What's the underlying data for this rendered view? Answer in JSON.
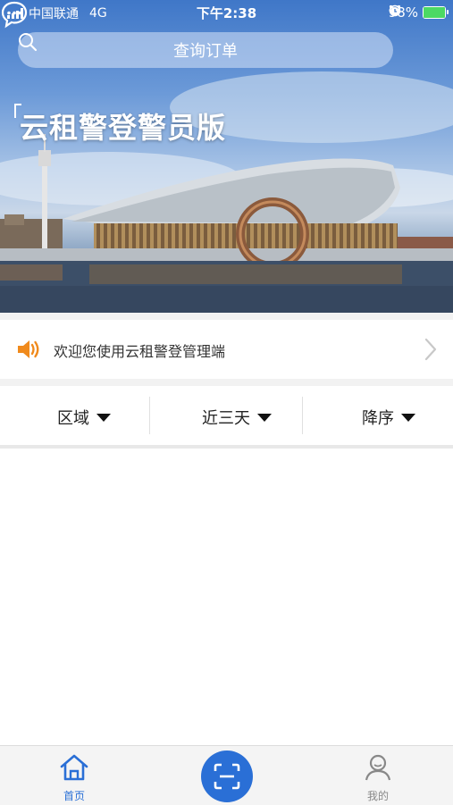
{
  "status_bar": {
    "carrier": "中国联通",
    "network": "4G",
    "time": "下午2:38",
    "battery_percent": "98%"
  },
  "header": {
    "search_label": "查询订单",
    "app_title": "云租警登警员版"
  },
  "notice": {
    "text": "欢迎您使用云租警登管理端"
  },
  "filters": [
    {
      "label": "区域"
    },
    {
      "label": "近三天"
    },
    {
      "label": "降序"
    }
  ],
  "tabbar": {
    "home_label": "首页",
    "mine_label": "我的"
  },
  "colors": {
    "accent": "#2a6fd6",
    "notice_icon": "#f08a1c",
    "tab_active": "#2a6fd6",
    "tab_inactive": "#888888"
  },
  "icons": {
    "search": "search-icon",
    "message": "chat-bubble-icon",
    "notice": "speaker-icon",
    "chevron": "chevron-right-icon",
    "home": "home-icon",
    "scan": "scan-icon",
    "user": "user-icon"
  }
}
